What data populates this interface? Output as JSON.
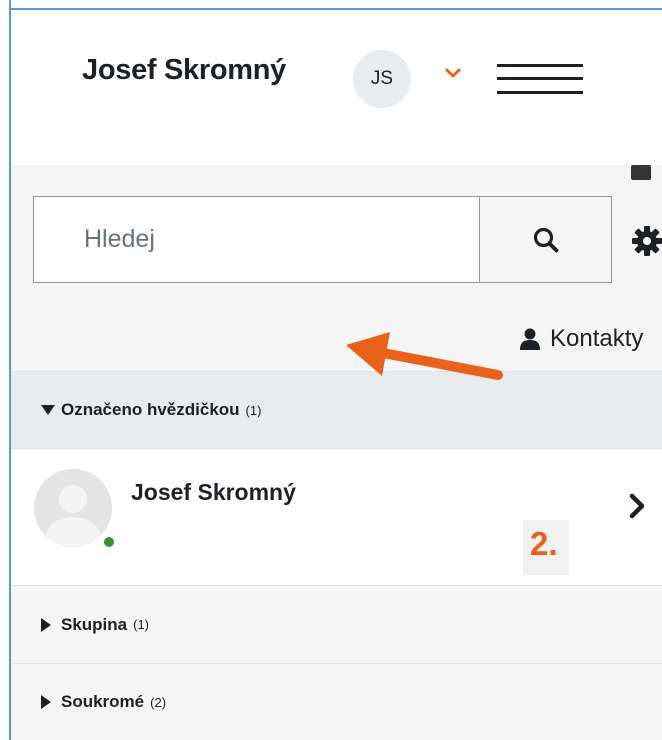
{
  "header": {
    "user_name": "Josef Skromný",
    "initials": "JS"
  },
  "search": {
    "placeholder": "Hledej"
  },
  "contacts_link": "Kontakty",
  "sections": {
    "starred": {
      "label": "Označeno hvězdičkou",
      "count": "(1)"
    },
    "group": {
      "label": "Skupina",
      "count": "(1)"
    },
    "private": {
      "label": "Soukromé",
      "count": "(2)"
    }
  },
  "starred_contacts": [
    {
      "name": "Josef Skromný",
      "status": "online"
    }
  ],
  "annotation": {
    "label": "2."
  },
  "colors": {
    "accent_orange": "#e8621a",
    "online_green": "#3a8f3a",
    "frame_border": "#5b9bd5"
  }
}
